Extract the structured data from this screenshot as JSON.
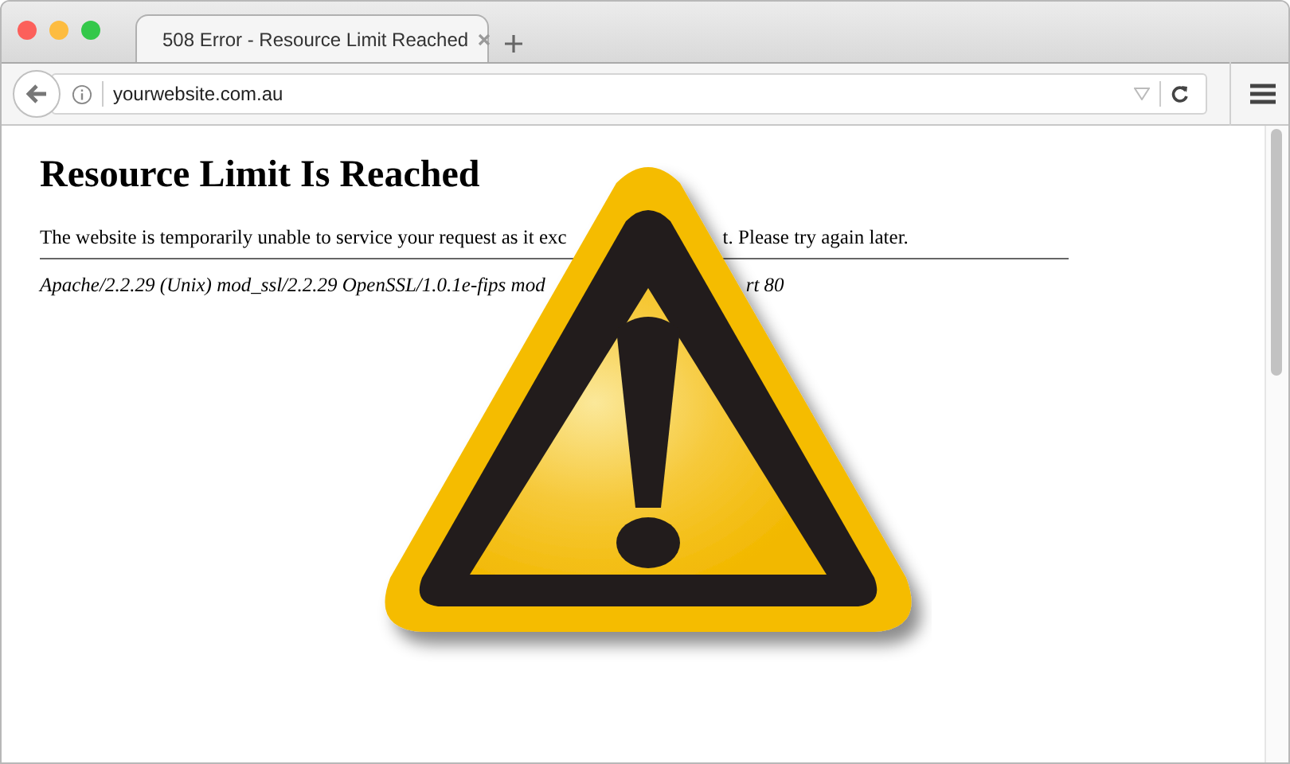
{
  "tabs": [
    {
      "label": "508 Error - Resource Limit Reached",
      "selected": true
    }
  ],
  "address_bar": {
    "value": "yourwebsite.com.au"
  },
  "page": {
    "heading": "Resource Limit Is Reached",
    "message": [
      "The website is temporarily unable to service your request as it exc",
      "t. Please try again later."
    ],
    "server_info": [
      "Apache/2.2.29 (Unix) mod_ssl/2.2.29 OpenSSL/1.0.1e-fips mod",
      "rt 80"
    ]
  }
}
